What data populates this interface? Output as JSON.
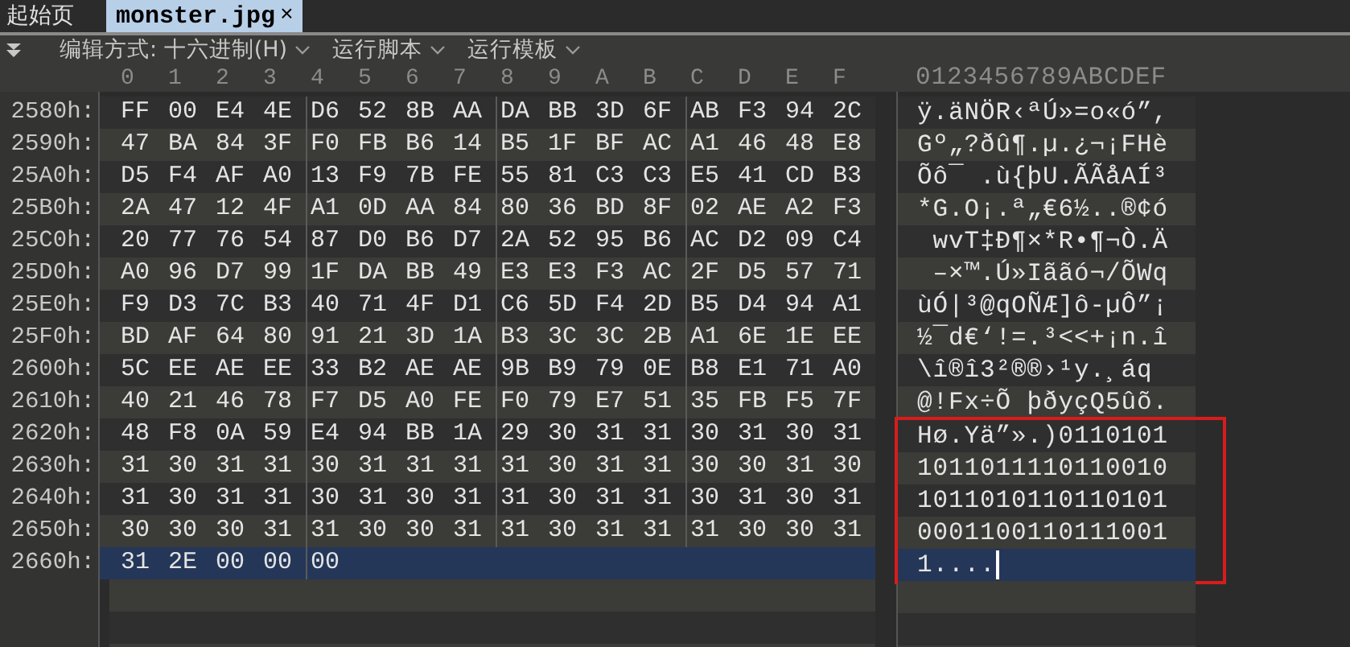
{
  "tabs": [
    {
      "label": "起始页",
      "selected": false
    },
    {
      "label": "monster.jpg",
      "selected": true,
      "close": "×"
    }
  ],
  "toolbar": [
    {
      "label": "编辑方式: 十六进制(H)"
    },
    {
      "label": "运行脚本"
    },
    {
      "label": "运行模板"
    }
  ],
  "hex_header": [
    "0",
    "1",
    "2",
    "3",
    "4",
    "5",
    "6",
    "7",
    "8",
    "9",
    "A",
    "B",
    "C",
    "D",
    "E",
    "F"
  ],
  "text_header": "0123456789ABCDEF",
  "rows": [
    {
      "address": "2580h:",
      "bytes": [
        "FF",
        "00",
        "E4",
        "4E",
        "D6",
        "52",
        "8B",
        "AA",
        "DA",
        "BB",
        "3D",
        "6F",
        "AB",
        "F3",
        "94",
        "2C"
      ],
      "text": "ÿ.äNÖR‹ªÚ»=o«ó”,",
      "selected": false,
      "boxed": false
    },
    {
      "address": "2590h:",
      "bytes": [
        "47",
        "BA",
        "84",
        "3F",
        "F0",
        "FB",
        "B6",
        "14",
        "B5",
        "1F",
        "BF",
        "AC",
        "A1",
        "46",
        "48",
        "E8"
      ],
      "text": "Gº„?ðû¶.µ.¿¬¡FHè",
      "selected": false,
      "boxed": false
    },
    {
      "address": "25A0h:",
      "bytes": [
        "D5",
        "F4",
        "AF",
        "A0",
        "13",
        "F9",
        "7B",
        "FE",
        "55",
        "81",
        "C3",
        "C3",
        "E5",
        "41",
        "CD",
        "B3"
      ],
      "text": "Õô¯ .ù{þU.ÃÃåAÍ³",
      "selected": false,
      "boxed": false
    },
    {
      "address": "25B0h:",
      "bytes": [
        "2A",
        "47",
        "12",
        "4F",
        "A1",
        "0D",
        "AA",
        "84",
        "80",
        "36",
        "BD",
        "8F",
        "02",
        "AE",
        "A2",
        "F3"
      ],
      "text": "*G.O¡.ª„€6½..®¢ó",
      "selected": false,
      "boxed": false
    },
    {
      "address": "25C0h:",
      "bytes": [
        "20",
        "77",
        "76",
        "54",
        "87",
        "D0",
        "B6",
        "D7",
        "2A",
        "52",
        "95",
        "B6",
        "AC",
        "D2",
        "09",
        "C4"
      ],
      "text": " wvT‡Ð¶×*R•¶¬Ò.Ä",
      "selected": false,
      "boxed": false
    },
    {
      "address": "25D0h:",
      "bytes": [
        "A0",
        "96",
        "D7",
        "99",
        "1F",
        "DA",
        "BB",
        "49",
        "E3",
        "E3",
        "F3",
        "AC",
        "2F",
        "D5",
        "57",
        "71"
      ],
      "text": " –×™.Ú»Iããó¬/ÕWq",
      "selected": false,
      "boxed": false
    },
    {
      "address": "25E0h:",
      "bytes": [
        "F9",
        "D3",
        "7C",
        "B3",
        "40",
        "71",
        "4F",
        "D1",
        "C6",
        "5D",
        "F4",
        "2D",
        "B5",
        "D4",
        "94",
        "A1"
      ],
      "text": "ùÓ|³@qOÑÆ]ô-µÔ”¡",
      "selected": false,
      "boxed": false
    },
    {
      "address": "25F0h:",
      "bytes": [
        "BD",
        "AF",
        "64",
        "80",
        "91",
        "21",
        "3D",
        "1A",
        "B3",
        "3C",
        "3C",
        "2B",
        "A1",
        "6E",
        "1E",
        "EE"
      ],
      "text": "½¯d€‘!=.³<<+¡n.î",
      "selected": false,
      "boxed": false
    },
    {
      "address": "2600h:",
      "bytes": [
        "5C",
        "EE",
        "AE",
        "EE",
        "33",
        "B2",
        "AE",
        "AE",
        "9B",
        "B9",
        "79",
        "0E",
        "B8",
        "E1",
        "71",
        "A0"
      ],
      "text": "\\î®î3²®®›¹y.¸áq",
      "selected": false,
      "boxed": false
    },
    {
      "address": "2610h:",
      "bytes": [
        "40",
        "21",
        "46",
        "78",
        "F7",
        "D5",
        "A0",
        "FE",
        "F0",
        "79",
        "E7",
        "51",
        "35",
        "FB",
        "F5",
        "7F"
      ],
      "text": "@!Fx÷Õ þðyçQ5ûõ.",
      "selected": false,
      "boxed": false
    },
    {
      "address": "2620h:",
      "bytes": [
        "48",
        "F8",
        "0A",
        "59",
        "E4",
        "94",
        "BB",
        "1A",
        "29",
        "30",
        "31",
        "31",
        "30",
        "31",
        "30",
        "31"
      ],
      "text": "Hø.Yä”».)0110101",
      "selected": false,
      "boxed": true
    },
    {
      "address": "2630h:",
      "bytes": [
        "31",
        "30",
        "31",
        "31",
        "30",
        "31",
        "31",
        "31",
        "31",
        "30",
        "31",
        "31",
        "30",
        "30",
        "31",
        "30"
      ],
      "text": "1011011110110010",
      "selected": false,
      "boxed": true
    },
    {
      "address": "2640h:",
      "bytes": [
        "31",
        "30",
        "31",
        "31",
        "30",
        "31",
        "30",
        "31",
        "31",
        "30",
        "31",
        "31",
        "30",
        "31",
        "30",
        "31"
      ],
      "text": "1011010110110101",
      "selected": false,
      "boxed": true
    },
    {
      "address": "2650h:",
      "bytes": [
        "30",
        "30",
        "30",
        "31",
        "31",
        "30",
        "30",
        "31",
        "31",
        "30",
        "31",
        "31",
        "31",
        "30",
        "30",
        "31"
      ],
      "text": "0001100110111001",
      "selected": false,
      "boxed": true
    },
    {
      "address": "2660h:",
      "bytes": [
        "31",
        "2E",
        "00",
        "00",
        "00"
      ],
      "text": "1....",
      "selected": true,
      "boxed": true
    }
  ]
}
